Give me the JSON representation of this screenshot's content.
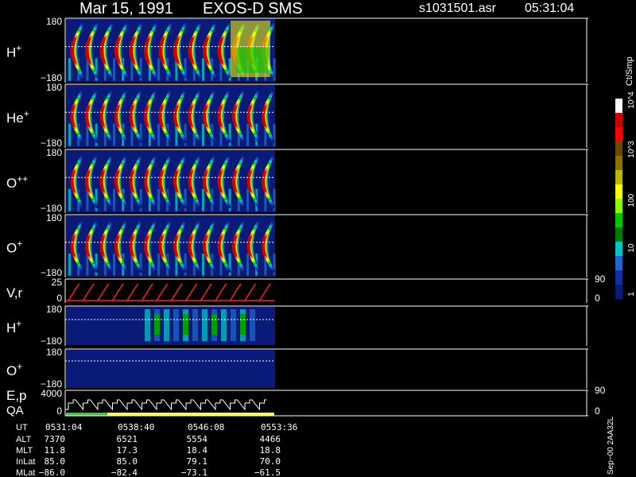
{
  "header": {
    "date": "Mar 15, 1991",
    "instrument": "EXOS-D SMS",
    "filename": "s1031501.asr",
    "time": "05:31:04"
  },
  "colorbar": {
    "unit": "Ct/Smp",
    "ticks": [
      "1",
      "10",
      "100",
      "10^3",
      "10^4"
    ],
    "colors": [
      "#ffffff",
      "#d00000",
      "#ff0000",
      "#6a4a00",
      "#8a7000",
      "#b8b800",
      "#ffff00",
      "#88ff00",
      "#00c800",
      "#007a00",
      "#00c8c8",
      "#1f66cc",
      "#1430a0",
      "#0a1a78"
    ]
  },
  "panels": [
    {
      "label": "H",
      "sup": "+",
      "ymax": "180",
      "ymin": "−180",
      "style": "spectro-full"
    },
    {
      "label": "He",
      "sup": "+",
      "ymax": "180",
      "ymin": "−180",
      "style": "spectro"
    },
    {
      "label": "O",
      "sup": "++",
      "ymax": "180",
      "ymin": "−180",
      "style": "spectro"
    },
    {
      "label": "O",
      "sup": "+",
      "ymax": "180",
      "ymin": "−180",
      "style": "spectro"
    },
    {
      "label": "V,r",
      "sup": "",
      "ymax": "25",
      "ymin": "0",
      "rmax": "90",
      "rmin": "0",
      "style": "line"
    },
    {
      "label": "H",
      "sup": "+",
      "ymax": "180",
      "ymin": "−180",
      "style": "sparse"
    },
    {
      "label": "O",
      "sup": "+",
      "ymax": "180",
      "ymin": "−180",
      "style": "empty"
    },
    {
      "label": "E,p",
      "label2": "QA",
      "sup": "",
      "ymax": "4000",
      "ymin": "0",
      "rmax": "90",
      "rmin": "0",
      "style": "steps"
    }
  ],
  "footer": {
    "row_labels": [
      "UT",
      "ALT",
      "MLT",
      "InLat",
      "MLat"
    ],
    "columns": [
      [
        "0531:04",
        "7370",
        "11.8",
        "85.0",
        "−86.0"
      ],
      [
        "0538:40",
        "6521",
        "17.3",
        "85.0",
        "−82.4"
      ],
      [
        "0546:08",
        "5554",
        "18.4",
        "79.1",
        "−73.1"
      ],
      [
        "0553:36",
        "4466",
        "18.8",
        "70.0",
        "−61.5"
      ]
    ],
    "side_note": "Sep−00  2AA32L"
  }
}
